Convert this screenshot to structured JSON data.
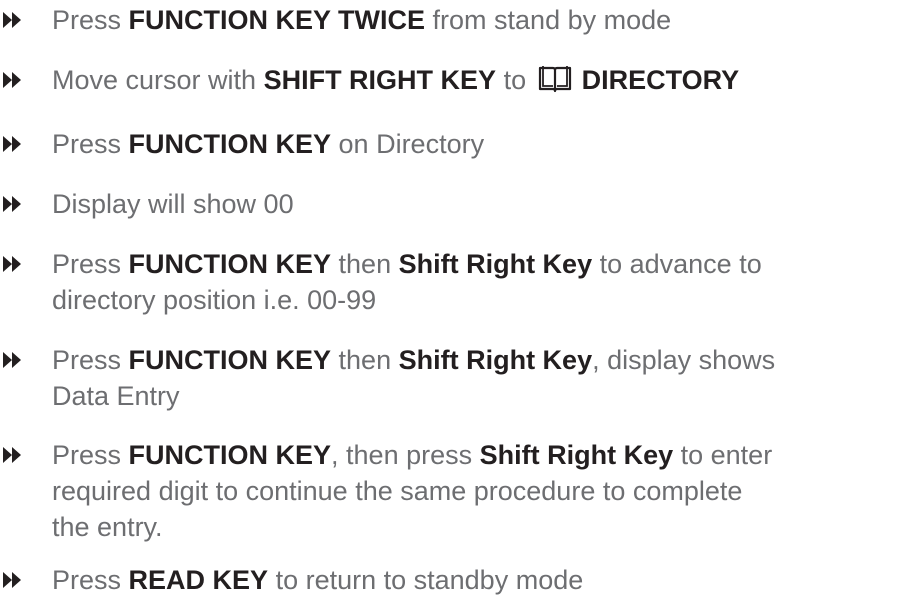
{
  "steps": [
    {
      "pre": "Press ",
      "b1": "FUNCTION KEY TWICE",
      "post": " from stand by mode"
    },
    {
      "pre": "Move cursor with ",
      "b1": "SHIFT RIGHT KEY",
      "mid": " to ",
      "icon": "book-icon",
      "b2": "DIRECTORY"
    },
    {
      "pre": "Press ",
      "b1": "FUNCTION KEY",
      "post": " on Directory"
    },
    {
      "text": "Display will show 00"
    },
    {
      "pre": "Press ",
      "b1": "FUNCTION KEY",
      "mid": " then ",
      "b2": "Shift Right Key",
      "post": " to advance to",
      "line2": "directory position i.e. 00-99"
    },
    {
      "pre": "Press ",
      "b1": "FUNCTION KEY",
      "mid": " then ",
      "b2": "Shift Right Key",
      "post": ", display shows",
      "line2": "Data Entry"
    },
    {
      "pre": "Press ",
      "b1": "FUNCTION KEY",
      "mid": ", then press ",
      "b2": "Shift Right Key",
      "post": " to enter",
      "line2": "required digit to continue the same procedure to complete",
      "line3": "the entry."
    },
    {
      "pre": "Press ",
      "b1": "READ KEY",
      "post": " to return to standby mode"
    }
  ],
  "colors": {
    "text": "#6d6e71",
    "bold": "#231f20",
    "bullet": "#231f20"
  }
}
